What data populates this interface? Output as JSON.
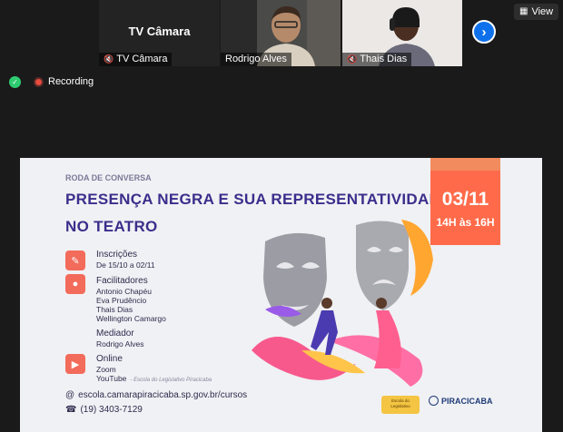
{
  "tiles": [
    {
      "name": "TV Câmara",
      "big_name": "TV Câmara",
      "muted": true
    },
    {
      "name": "Rodrigo Alves",
      "muted": false
    },
    {
      "name": "Thais Dias",
      "muted": true
    }
  ],
  "view_label": "View",
  "recording_label": "Recording",
  "slide": {
    "kicker": "RODA DE CONVERSA",
    "title_line1": "PRESENÇA NEGRA E SUA REPRESENTATIVIDADE",
    "title_line2": "NO TEATRO",
    "date": "03/11",
    "hours": "14H às 16H",
    "inscricoes_label": "Inscrições",
    "inscricoes_dates": "De 15/10 a 02/11",
    "facilitadores_label": "Facilitadores",
    "facilitadores": [
      "Antonio Chapéu",
      "Eva Prudêncio",
      "Thais Dias",
      "Wellington Camargo"
    ],
    "mediador_label": "Mediador",
    "mediador": "Rodrigo Alves",
    "online_label": "Online",
    "online_zoom": "Zoom",
    "online_youtube": "YouTube",
    "online_note": "- Escola do Legislativo Piracicaba",
    "website": "escola.camarapiracicaba.sp.gov.br/cursos",
    "phone": "(19) 3403-7129",
    "logo_right": "PIRACICABA"
  }
}
